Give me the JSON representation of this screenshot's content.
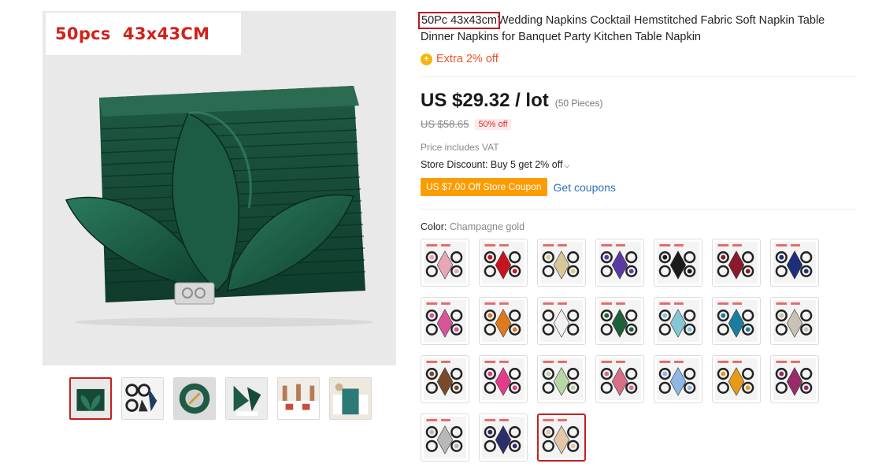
{
  "gallery": {
    "badge_text": "50pcs  43x43CM",
    "thumbnails": [
      {
        "name": "green-napkin-stack"
      },
      {
        "name": "napkin-set-grid"
      },
      {
        "name": "green-place-setting"
      },
      {
        "name": "folded-green-napkins"
      },
      {
        "name": "banquet-hall"
      },
      {
        "name": "table-runner"
      }
    ]
  },
  "product": {
    "title_highlight": "50Pc 43x43cm",
    "title_rest": "Wedding Napkins Cocktail Hemstitched Fabric Soft Napkin Table Dinner Napkins for Banquet Party Kitchen Table Napkin",
    "extra_off": "Extra 2% off",
    "extra_icon": "coin-icon",
    "price": "US $29.32 / lot",
    "pieces": "(50 Pieces)",
    "original_price": "US $58.65",
    "discount": "50% off",
    "vat_note": "Price includes VAT",
    "store_discount": "Store Discount: Buy 5 get 2% off",
    "coupon": "US $7.00 Off Store Coupon",
    "get_coupons": "Get coupons",
    "color_label": "Color: ",
    "color_value": "Champagne gold",
    "accent_color": "#c81e1e",
    "price_color": "#191919",
    "coupon_color": "#fb9c00"
  },
  "swatches": [
    {
      "color": "#e8a7b6"
    },
    {
      "color": "#c8141c"
    },
    {
      "color": "#d8c79a"
    },
    {
      "color": "#5a3aa3"
    },
    {
      "color": "#1b1b1b"
    },
    {
      "color": "#8a1a2c"
    },
    {
      "color": "#1e2f7a"
    },
    {
      "color": "#d9559a"
    },
    {
      "color": "#e07a1f"
    },
    {
      "color": "#f2f2f2"
    },
    {
      "color": "#1f5f3b"
    },
    {
      "color": "#86c7d6"
    },
    {
      "color": "#1b7da0"
    },
    {
      "color": "#c9c3b5"
    },
    {
      "color": "#7a4a2a"
    },
    {
      "color": "#e33d8a"
    },
    {
      "color": "#b9d7a5"
    },
    {
      "color": "#d96f85"
    },
    {
      "color": "#8fb6e6"
    },
    {
      "color": "#e59a1a"
    },
    {
      "color": "#9a2a6a"
    },
    {
      "color": "#b8b8b8"
    },
    {
      "color": "#2a2f6b"
    },
    {
      "color": "#e2c7a8",
      "selected": true
    }
  ]
}
